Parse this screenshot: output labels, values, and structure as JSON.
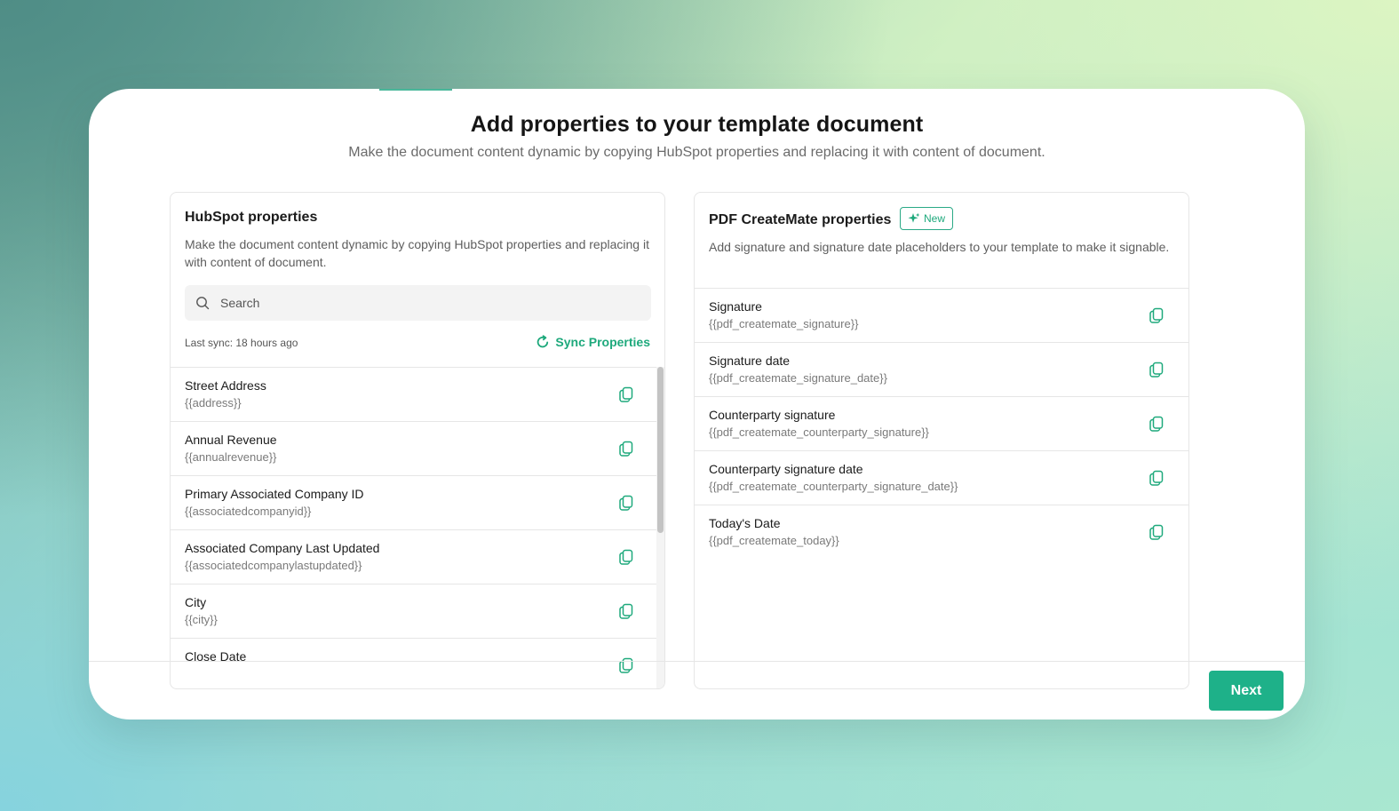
{
  "page": {
    "title": "Add properties to your template document",
    "subtitle": "Make the document content dynamic by copying HubSpot properties and replacing it with content of document."
  },
  "hubspot": {
    "title": "HubSpot properties",
    "description": "Make the document content dynamic by copying HubSpot properties and replacing it with content of document.",
    "search_placeholder": "Search",
    "last_sync": "Last sync: 18 hours ago",
    "sync_label": "Sync Properties",
    "items": [
      {
        "label": "Street Address",
        "token": "{{address}}"
      },
      {
        "label": "Annual Revenue",
        "token": "{{annualrevenue}}"
      },
      {
        "label": "Primary Associated Company ID",
        "token": "{{associatedcompanyid}}"
      },
      {
        "label": "Associated Company Last Updated",
        "token": "{{associatedcompanylastupdated}}"
      },
      {
        "label": "City",
        "token": "{{city}}"
      },
      {
        "label": "Close Date",
        "token": ""
      }
    ]
  },
  "pdf": {
    "title": "PDF CreateMate properties",
    "badge": "New",
    "description": "Add signature and signature date placeholders to your template to make it signable.",
    "items": [
      {
        "label": "Signature",
        "token": "{{pdf_createmate_signature}}"
      },
      {
        "label": "Signature date",
        "token": "{{pdf_createmate_signature_date}}"
      },
      {
        "label": "Counterparty signature",
        "token": "{{pdf_createmate_counterparty_signature}}"
      },
      {
        "label": "Counterparty signature date",
        "token": "{{pdf_createmate_counterparty_signature_date}}"
      },
      {
        "label": "Today's Date",
        "token": "{{pdf_createmate_today}}"
      }
    ]
  },
  "footer": {
    "next_label": "Next"
  },
  "colors": {
    "accent": "#1eb189",
    "text": "#1b1b1b",
    "muted": "#7a7a7a"
  },
  "icons": {
    "search": "search-icon",
    "sync": "refresh-icon",
    "copy": "copy-icon",
    "badge": "sparkle-icon"
  }
}
